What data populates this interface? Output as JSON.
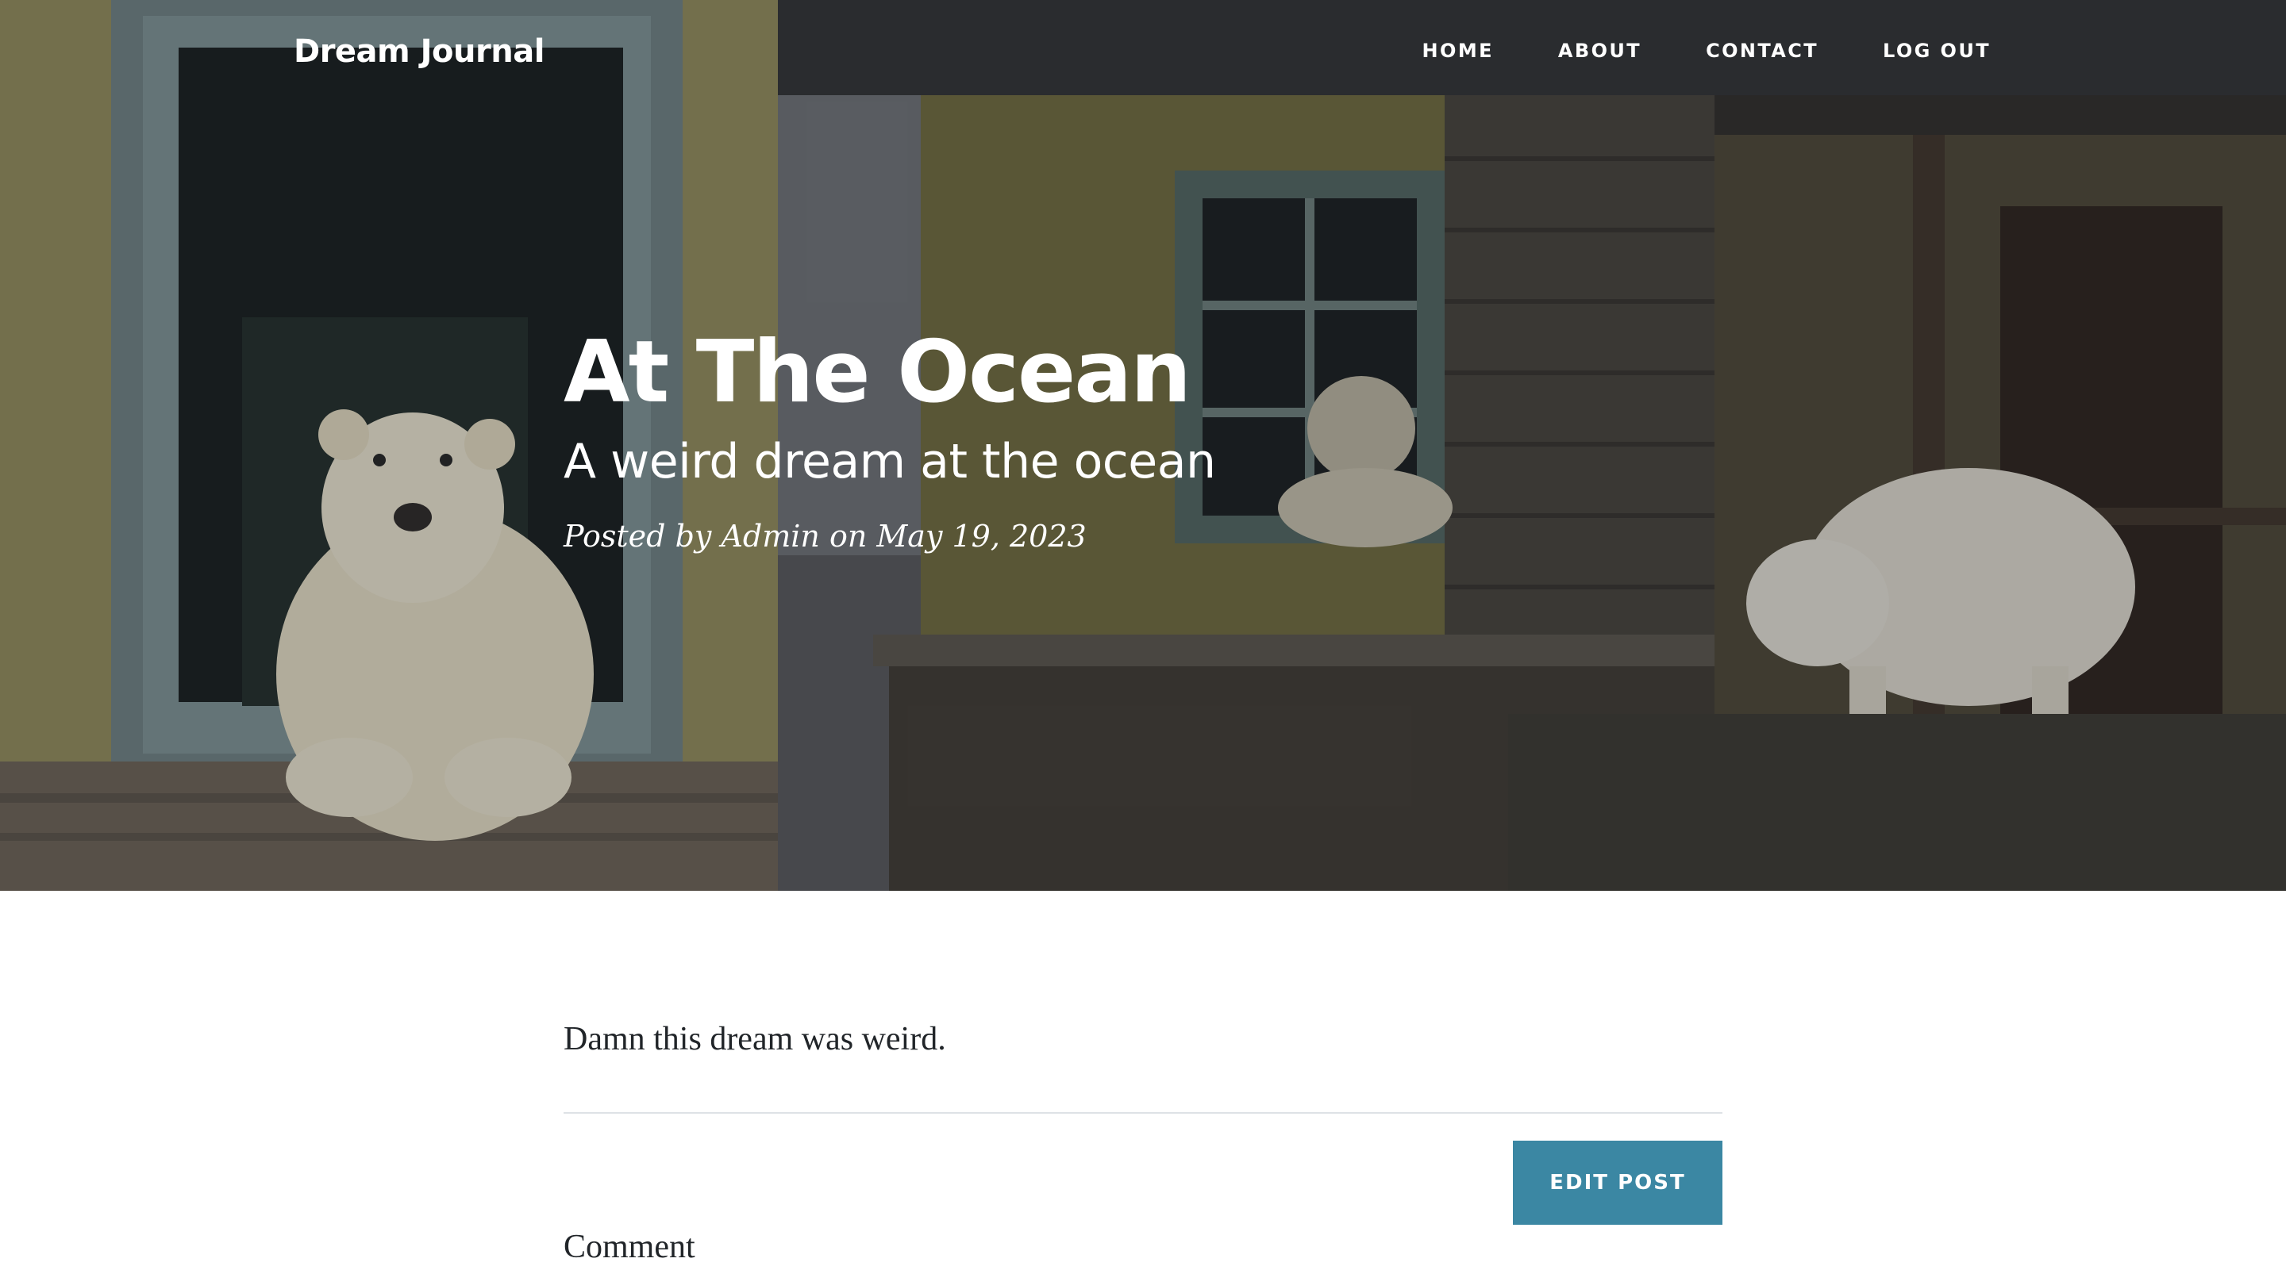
{
  "nav": {
    "brand": "Dream Journal",
    "links": [
      "HOME",
      "ABOUT",
      "CONTACT",
      "LOG OUT"
    ]
  },
  "post": {
    "title": "At The Ocean",
    "subtitle": "A weird dream at the ocean",
    "meta": "Posted by Admin on May 19, 2023",
    "body": "Damn this dream was weird."
  },
  "actions": {
    "edit_label": "EDIT POST"
  },
  "comments": {
    "label": "Comment"
  },
  "colors": {
    "accent": "#3b87a3",
    "text": "#212529",
    "divider": "#dee2e6"
  }
}
